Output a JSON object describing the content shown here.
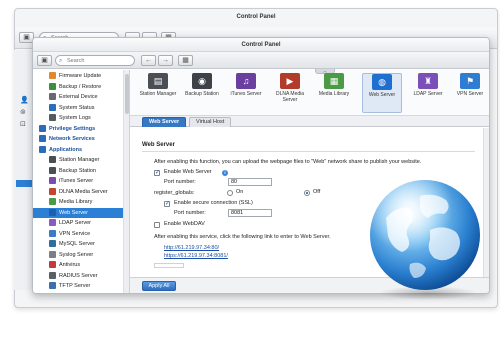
{
  "back_window": {
    "title": "Control Panel",
    "search_placeholder": "Search"
  },
  "window": {
    "title": "Control Panel",
    "search_placeholder": "Search",
    "back_glyph": "←",
    "forward_glyph": "→",
    "grid_glyph": "▦",
    "home_glyph": "▣"
  },
  "sidebar": {
    "items": [
      {
        "label": "Firmware Update",
        "kind": "item",
        "color": "#e08a2c"
      },
      {
        "label": "Backup / Restore",
        "kind": "item",
        "color": "#3a8f3a"
      },
      {
        "label": "External Device",
        "kind": "item",
        "color": "#666a70"
      },
      {
        "label": "System Status",
        "kind": "item",
        "color": "#2c6db8"
      },
      {
        "label": "System Logs",
        "kind": "item",
        "color": "#555a61"
      },
      {
        "label": "Privilege Settings",
        "kind": "cat",
        "color": "#2c6db8"
      },
      {
        "label": "Network Services",
        "kind": "cat",
        "color": "#2c6db8"
      },
      {
        "label": "Applications",
        "kind": "cat",
        "color": "#2c6db8"
      },
      {
        "label": "Station Manager",
        "kind": "item",
        "color": "#4a4e55"
      },
      {
        "label": "Backup Station",
        "kind": "item",
        "color": "#4a4e55"
      },
      {
        "label": "iTunes Server",
        "kind": "item",
        "color": "#7b4bb0"
      },
      {
        "label": "DLNA Media Server",
        "kind": "item",
        "color": "#c2462e"
      },
      {
        "label": "Media Library",
        "kind": "item",
        "color": "#4b9a45"
      },
      {
        "label": "Web Server",
        "kind": "sel",
        "color": "#1a5fb0"
      },
      {
        "label": "LDAP Server",
        "kind": "item",
        "color": "#8a5bc0"
      },
      {
        "label": "VPN Service",
        "kind": "item",
        "color": "#3a7ac8"
      },
      {
        "label": "MySQL Server",
        "kind": "item",
        "color": "#2e6fa0"
      },
      {
        "label": "Syslog Server",
        "kind": "item",
        "color": "#7a7e85"
      },
      {
        "label": "Antivirus",
        "kind": "item",
        "color": "#c23a3a"
      },
      {
        "label": "RADIUS Server",
        "kind": "item",
        "color": "#5a5e65"
      },
      {
        "label": "TFTP Server",
        "kind": "item",
        "color": "#3a6fb0"
      }
    ]
  },
  "apps": [
    {
      "label": "Station Manager",
      "color": "#4a4e55",
      "glyph": "▤"
    },
    {
      "label": "Backup Station",
      "color": "#3d4248",
      "glyph": "◉"
    },
    {
      "label": "iTunes Server",
      "color": "#6b3fa0",
      "glyph": "♫"
    },
    {
      "label": "DLNA Media Server",
      "color": "#b23c2a",
      "glyph": "▶"
    },
    {
      "label": "Media Library",
      "color": "#4b9a45",
      "glyph": "▦"
    },
    {
      "label": "Web Server",
      "color": "#1e6fd0",
      "glyph": "◍"
    },
    {
      "label": "LDAP Server",
      "color": "#7a4fb8",
      "glyph": "♜"
    },
    {
      "label": "VPN Server",
      "color": "#2f7dd0",
      "glyph": "⚑"
    }
  ],
  "tabs": [
    "Web Server",
    "Virtual Host"
  ],
  "web_server": {
    "section_title": "Web Server",
    "description": "After enabling this function, you can upload the webpage files to \"Web\" network share to publish your website.",
    "enable_label": "Enable Web Server",
    "port_label": "Port number:",
    "port_value": "80",
    "register_globals_label": "register_globals:",
    "on_label": "On",
    "off_label": "Off",
    "ssl_label": "Enable secure connection (SSL)",
    "ssl_port_label": "Port number:",
    "ssl_port_value": "8081",
    "webdav_label": "Enable WebDAV",
    "note": "After enabling this service, click the following link to enter to Web Server.",
    "link_http": "http://61.219.97.34:80/",
    "link_https": "https://61.219.97.34:8081/"
  },
  "footer": {
    "apply_label": "Apply All"
  }
}
